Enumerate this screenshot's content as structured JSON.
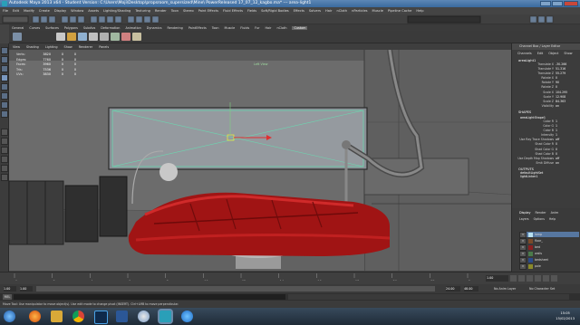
{
  "window": {
    "title": "Autodesk Maya 2013 x64 - Student Version: C:\\Users\\Moji\\Desktop\\propsroom_supersized\\Mine\\ PowerReleased 17_07_12_kagbo.ma* --- area-light1"
  },
  "menubar": {
    "items": [
      "File",
      "Edit",
      "Modify",
      "Create",
      "Display",
      "Window",
      "Assets",
      "Lighting/Shading",
      "Texturing",
      "Render",
      "Toon",
      "Stereo",
      "Paint Effects",
      "Fluid Effects",
      "Fields",
      "Soft/Rigid Bodies",
      "Effects",
      "Solvers",
      "Hair",
      "nCloth",
      "nParticles",
      "Muscle",
      "Pipeline Cache",
      "Help"
    ]
  },
  "shelf": {
    "tabs": [
      "General",
      "Curves",
      "Surfaces",
      "Polygons",
      "Subdivs",
      "Deformation",
      "Animation",
      "Dynamics",
      "Rendering",
      "PaintEffects",
      "Toon",
      "Muscle",
      "Fluids",
      "Fur",
      "Hair",
      "nCloth",
      "Custom"
    ],
    "active_tab": "Custom"
  },
  "panel_menu": {
    "items": [
      "View",
      "Shading",
      "Lighting",
      "Show",
      "Renderer",
      "Panels"
    ]
  },
  "hud": {
    "rows": [
      {
        "label": "Verts:",
        "v1": "3820",
        "v2": "0",
        "v3": "0"
      },
      {
        "label": "Edges:",
        "v1": "7760",
        "v2": "0",
        "v3": "0"
      },
      {
        "label": "Faces:",
        "v1": "3960",
        "v2": "0",
        "v3": "0"
      },
      {
        "label": "Tris:",
        "v1": "7536",
        "v2": "0",
        "v3": "0"
      },
      {
        "label": "UVs:",
        "v1": "3830",
        "v2": "0",
        "v3": "0"
      }
    ]
  },
  "viewport": {
    "camera_label": "Left View"
  },
  "channel_box": {
    "header": "Channel Box / Layer Editor",
    "tabs": [
      "Channels",
      "Edit",
      "Object",
      "Show"
    ],
    "object_name": "areaLight1",
    "transform_attrs": [
      {
        "name": "Translate X",
        "value": "-30.266"
      },
      {
        "name": "Translate Y",
        "value": "51.316"
      },
      {
        "name": "Translate Z",
        "value": "55.279"
      },
      {
        "name": "Rotate X",
        "value": "0"
      },
      {
        "name": "Rotate Y",
        "value": "90"
      },
      {
        "name": "Rotate Z",
        "value": "0"
      },
      {
        "name": "Scale X",
        "value": "104.295"
      },
      {
        "name": "Scale Y",
        "value": "12.908"
      },
      {
        "name": "Scale Z",
        "value": "84.363"
      },
      {
        "name": "Visibility",
        "value": "on"
      }
    ],
    "shapes_label": "SHAPES",
    "shape_name": "areaLightShape1",
    "shape_attrs": [
      {
        "name": "Color R",
        "value": "1"
      },
      {
        "name": "Color G",
        "value": "1"
      },
      {
        "name": "Color B",
        "value": "1"
      },
      {
        "name": "Intensity",
        "value": "1"
      },
      {
        "name": "Use Ray Trace Shadows",
        "value": "off"
      },
      {
        "name": "Shad Color R",
        "value": "0"
      },
      {
        "name": "Shad Color G",
        "value": "0"
      },
      {
        "name": "Shad Color B",
        "value": "0"
      },
      {
        "name": "Use Depth Map Shadows",
        "value": "off"
      },
      {
        "name": "Emit Diffuse",
        "value": "on"
      }
    ],
    "outputs_label": "OUTPUTS",
    "outputs": [
      "defaultLightSet",
      "lightLinker1"
    ]
  },
  "layer_editor": {
    "tabs": [
      "Display",
      "Render",
      "Anim"
    ],
    "active_tab": "Display",
    "menu": [
      "Layers",
      "Options",
      "Help"
    ],
    "layers": [
      {
        "name": "lamp",
        "color": "#b8e0f0",
        "selected": true
      },
      {
        "name": "floor_",
        "color": "#7a4a2a",
        "selected": false
      },
      {
        "name": "bed",
        "color": "#8a2020",
        "selected": false
      },
      {
        "name": "walls",
        "color": "#4a7a4a",
        "selected": false
      },
      {
        "name": "bedsheet",
        "color": "#2a4a8a",
        "selected": false
      },
      {
        "name": "pole",
        "color": "#8a8a2a",
        "selected": false
      }
    ]
  },
  "time_slider": {
    "tick_labels": [
      "1",
      "2",
      "4",
      "6",
      "8",
      "10",
      "12",
      "14",
      "16",
      "18",
      "20",
      "22",
      "24"
    ],
    "current_frame": "1.00"
  },
  "range_slider": {
    "start": "1.00",
    "inner_start": "1.00",
    "inner_end": "24.00",
    "end": "48.00",
    "anim_layer": "No Anim Layer",
    "char_set": "No Character Set"
  },
  "help_line": "Move Tool: Use manipulator to move object(s). Use edit mode to change pivot (INSERT). Ctrl+LMB to move perpendicular.",
  "taskbar": {
    "icons": [
      "windows-start",
      "firefox",
      "explorer",
      "chrome",
      "photoshop",
      "word",
      "itunes",
      "maya",
      "ie"
    ],
    "time": "15:05",
    "date": "15/02/2013"
  }
}
